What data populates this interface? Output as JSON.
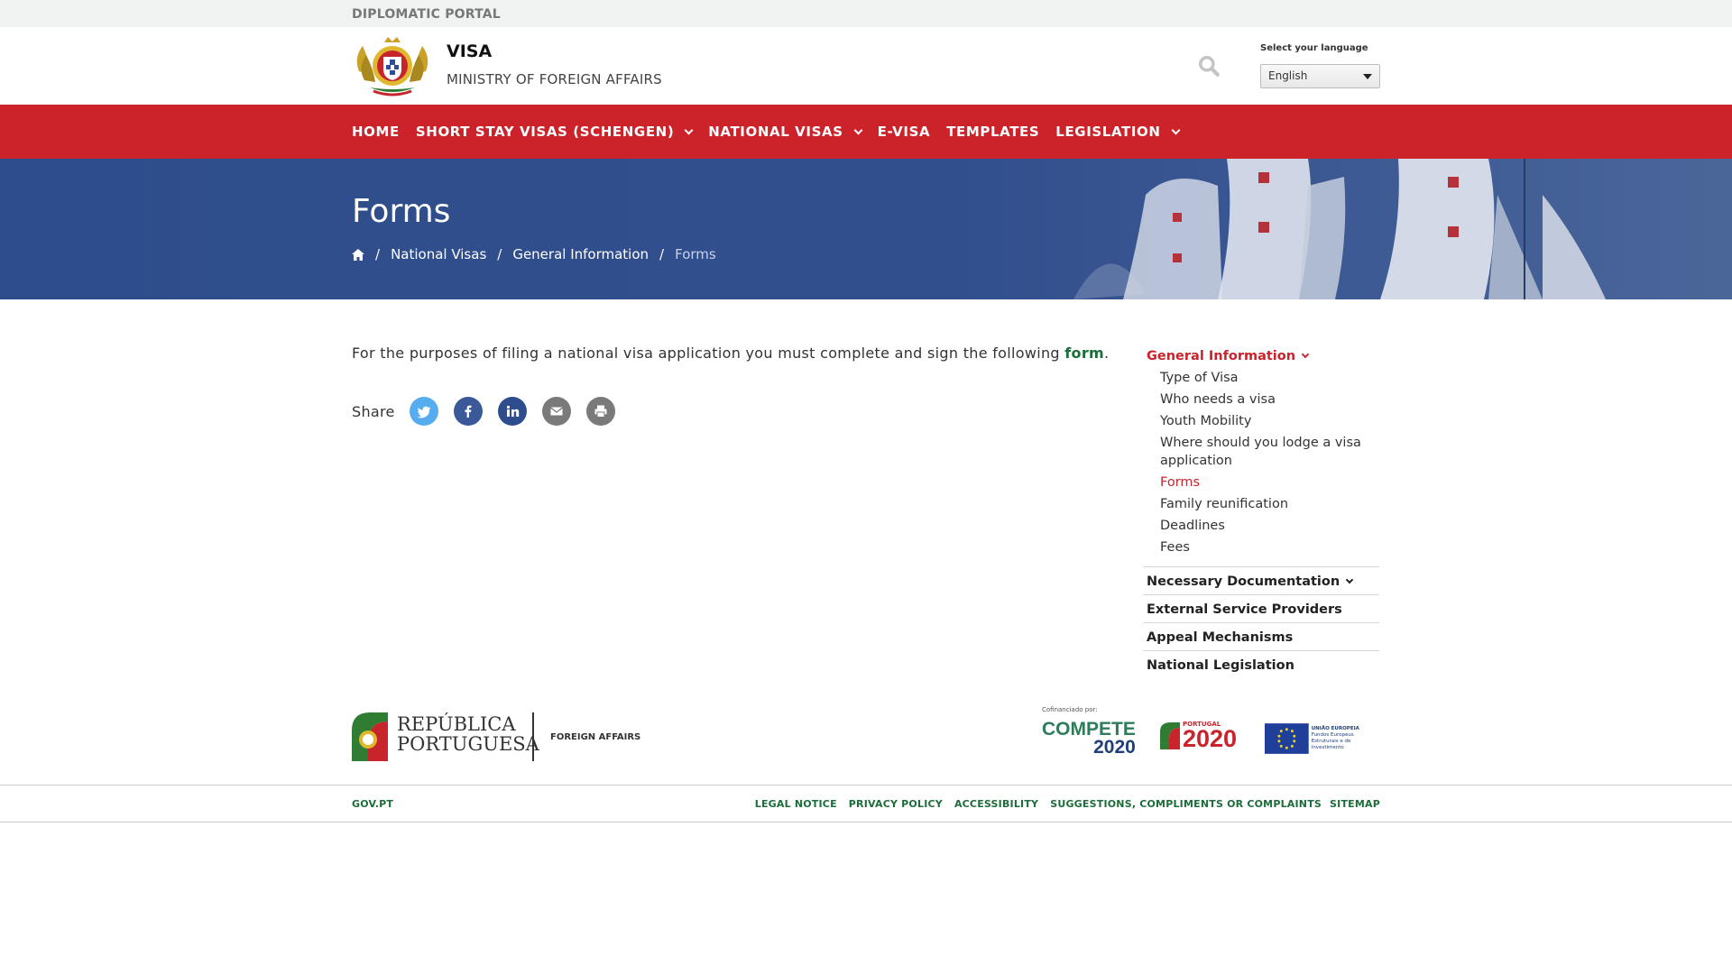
{
  "top": {
    "portal": "DIPLOMATIC PORTAL"
  },
  "header": {
    "title": "VISA",
    "subtitle": "MINISTRY OF FOREIGN AFFAIRS",
    "search_icon": "search-icon",
    "language_label": "Select your language",
    "language_value": "English"
  },
  "nav": {
    "items": [
      {
        "label": "HOME",
        "dropdown": false
      },
      {
        "label": "SHORT STAY VISAS (SCHENGEN)",
        "dropdown": true
      },
      {
        "label": "NATIONAL VISAS",
        "dropdown": true
      },
      {
        "label": "E-VISA",
        "dropdown": false
      },
      {
        "label": "TEMPLATES",
        "dropdown": false
      },
      {
        "label": "LEGISLATION",
        "dropdown": true
      }
    ]
  },
  "hero": {
    "title": "Forms",
    "breadcrumb": [
      "National Visas",
      "General Information",
      "Forms"
    ]
  },
  "content": {
    "intro": "For the purposes of filing a national visa application you must complete and sign the following",
    "intro_link": "form",
    "intro_end": ".",
    "share_label": "Share",
    "share_buttons": [
      {
        "name": "twitter-icon",
        "color": "#55acee"
      },
      {
        "name": "facebook-icon",
        "color": "#3b5998"
      },
      {
        "name": "linkedin-icon",
        "color": "#2e4d8c"
      },
      {
        "name": "email-icon",
        "color": "#7a7a7a"
      },
      {
        "name": "print-icon",
        "color": "#7a7a7a"
      }
    ]
  },
  "sidebar": {
    "active_section": "General Information",
    "items": [
      "Type of Visa",
      "Who needs a visa",
      "Youth Mobility",
      "Where should you lodge a visa application",
      "Forms",
      "Family reunification",
      "Deadlines",
      "Fees"
    ],
    "active_item": "Forms",
    "sections": [
      "Necessary Documentation",
      "External Service Providers",
      "Appeal Mechanisms",
      "National Legislation"
    ]
  },
  "footer": {
    "rp_line1": "REPÚBLICA",
    "rp_line2": "PORTUGUESA",
    "foreign_affairs": "FOREIGN AFFAIRS",
    "cofinanced": "Cofinanciado por:",
    "compete": "COMPETE",
    "compete_year": "2020",
    "portugal": "PORTUGAL",
    "portugal_year": "2020",
    "eu_line1": "UNIÃO EUROPEIA",
    "eu_line2": "Fundos Europeus",
    "eu_line3": "Estruturais e de Investimento",
    "gov": "GOV.PT",
    "links": [
      "LEGAL NOTICE",
      "PRIVACY POLICY",
      "ACCESSIBILITY",
      "SUGGESTIONS, COMPLIMENTS OR COMPLAINTS",
      "SITEMAP"
    ]
  },
  "colors": {
    "nav_red": "#cc2229",
    "accent_green": "#1b6d3a",
    "active_red": "#c8242b",
    "hero_blue": "#2e4d8c"
  }
}
